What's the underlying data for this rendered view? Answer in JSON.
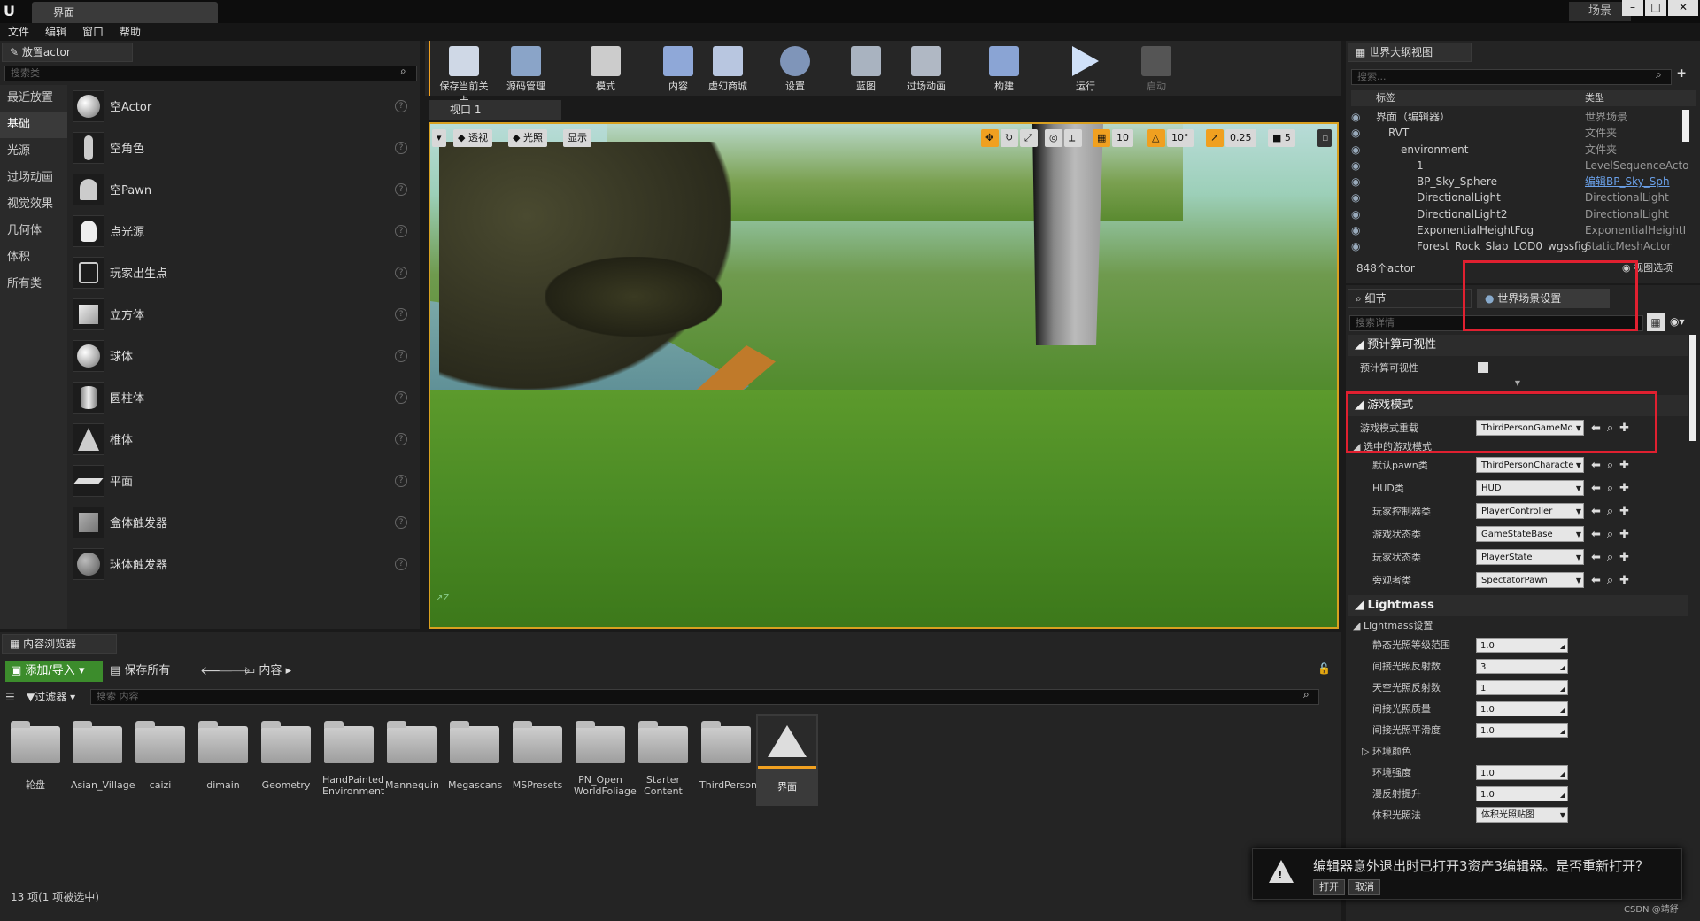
{
  "title_bar": {
    "tab": "界面",
    "project": "场景"
  },
  "menu": [
    "文件",
    "编辑",
    "窗口",
    "帮助"
  ],
  "place_actors": {
    "tab": "放置actor",
    "search_placeholder": "搜索类",
    "categories": [
      "最近放置",
      "基础",
      "光源",
      "过场动画",
      "视觉效果",
      "几何体",
      "体积",
      "所有类"
    ],
    "items": [
      "空Actor",
      "空角色",
      "空Pawn",
      "点光源",
      "玩家出生点",
      "立方体",
      "球体",
      "圆柱体",
      "椎体",
      "平面",
      "盒体触发器",
      "球体触发器"
    ]
  },
  "toolbar": [
    "保存当前关卡",
    "源码管理",
    "模式",
    "内容",
    "虚幻商城",
    "设置",
    "蓝图",
    "过场动画",
    "构建",
    "运行",
    "启动"
  ],
  "viewport": {
    "tab": "视口 1",
    "perspective": "透视",
    "lit": "光照",
    "show": "显示",
    "grid": "10",
    "angle": "10°",
    "scale": "0.25",
    "camspeed": "5"
  },
  "outliner": {
    "tab": "世界大纲视图",
    "search": "搜索...",
    "col_label": "标签",
    "col_type": "类型",
    "rows": [
      {
        "label": "界面（编辑器）",
        "type": "世界场景",
        "indent": 0
      },
      {
        "label": "RVT",
        "type": "文件夹",
        "indent": 1
      },
      {
        "label": "environment",
        "type": "文件夹",
        "indent": 2
      },
      {
        "label": "1",
        "type": "LevelSequenceActo",
        "indent": 3
      },
      {
        "label": "BP_Sky_Sphere",
        "type": "编辑BP_Sky_Sph",
        "indent": 3
      },
      {
        "label": "DirectionalLight",
        "type": "DirectionalLight",
        "indent": 3
      },
      {
        "label": "DirectionalLight2",
        "type": "DirectionalLight",
        "indent": 3
      },
      {
        "label": "ExponentialHeightFog",
        "type": "ExponentialHeightI",
        "indent": 3
      },
      {
        "label": "Forest_Rock_Slab_LOD0_wgssfig",
        "type": "StaticMeshActor",
        "indent": 3
      }
    ],
    "count": "848个actor",
    "view_options": "视图选项"
  },
  "details": {
    "tab_details": "细节",
    "tab_world": "世界场景设置",
    "search": "搜索详情",
    "sec_precomp": "预计算可视性",
    "precomp_label": "预计算可视性",
    "sec_game": "游戏模式",
    "gm_override_label": "游戏模式重载",
    "gm_override": "ThirdPersonGameMo",
    "selected_gm": "选中的游戏模式",
    "gm_rows": [
      {
        "label": "默认pawn类",
        "value": "ThirdPersonCharacte"
      },
      {
        "label": "HUD类",
        "value": "HUD"
      },
      {
        "label": "玩家控制器类",
        "value": "PlayerController"
      },
      {
        "label": "游戏状态类",
        "value": "GameStateBase"
      },
      {
        "label": "玩家状态类",
        "value": "PlayerState"
      },
      {
        "label": "旁观者类",
        "value": "SpectatorPawn"
      }
    ],
    "sec_lightmass": "Lightmass",
    "lm_settings": "Lightmass设置",
    "lm_rows": [
      {
        "label": "静态光照等级范围",
        "value": "1.0"
      },
      {
        "label": "间接光照反射数",
        "value": "3"
      },
      {
        "label": "天空光照反射数",
        "value": "1"
      },
      {
        "label": "间接光照质量",
        "value": "1.0"
      },
      {
        "label": "间接光照平滑度",
        "value": "1.0"
      }
    ],
    "env_color": "环境颜色",
    "env_intensity": "环境强度",
    "env_intensity_v": "1.0",
    "diffuse_boost": "漫反射提升",
    "diffuse_boost_v": "1.0",
    "vol_method": "体积光照法",
    "vol_method_v": "体积光照贴图"
  },
  "content_browser": {
    "tab": "内容浏览器",
    "add": "添加/导入",
    "save_all": "保存所有",
    "path": "内容",
    "filters": "过滤器",
    "search": "搜索 内容",
    "folders": [
      "轮盘",
      "Asian_Village",
      "caizi",
      "dimain",
      "Geometry",
      "HandPainted Environment",
      "Mannequin",
      "Megascans",
      "MSPresets",
      "PN_Open WorldFoliage",
      "Starter Content",
      "ThirdPerson",
      "界面"
    ],
    "status": "13 项(1 项被选中)"
  },
  "notification": {
    "text": "编辑器意外退出时已打开3资产3编辑器。是否重新打开？",
    "open": "打开",
    "cancel": "取消"
  },
  "watermark": "CSDN @靖舒",
  "colors": {
    "accent_orange": "#f0a020",
    "highlight_red": "#e02030",
    "add_green": "#3c8c2c"
  }
}
